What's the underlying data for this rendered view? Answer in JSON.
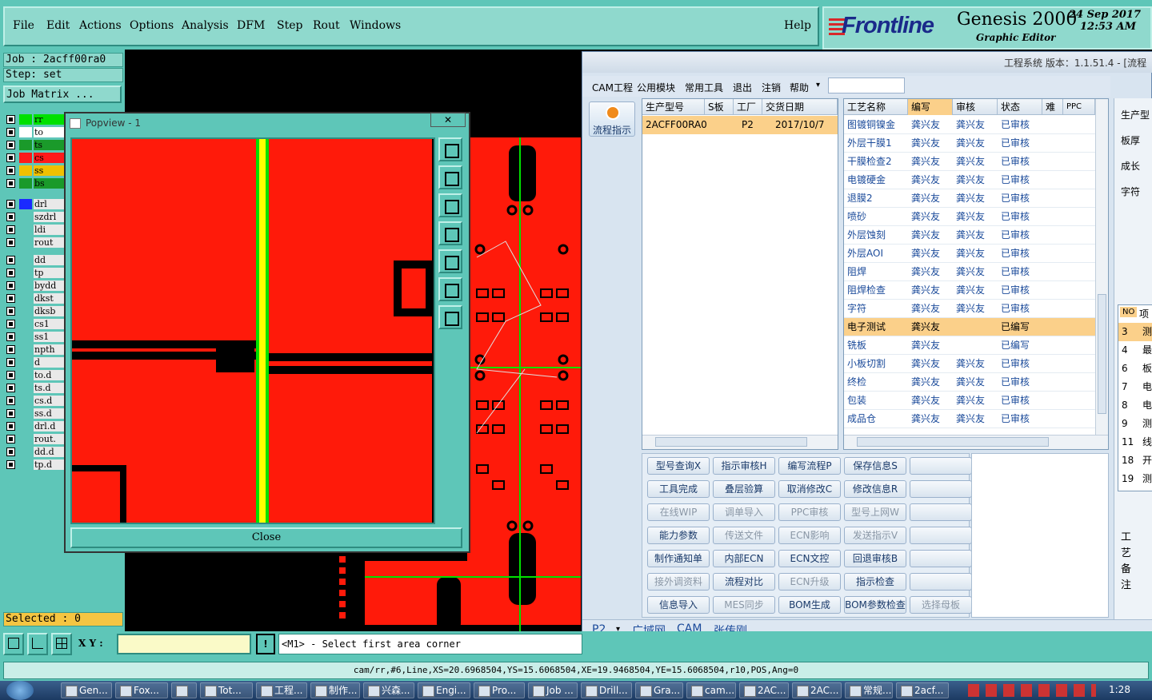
{
  "menu": {
    "items": [
      "File",
      "Edit",
      "Actions",
      "Options",
      "Analysis",
      "DFM",
      "Step",
      "Rout",
      "Windows"
    ],
    "help": "Help"
  },
  "logo": {
    "brand": "Frontline",
    "product": "Genesis 2000",
    "subtitle": "Graphic Editor",
    "date": "24 Sep 2017",
    "time": "12:53 AM"
  },
  "left": {
    "job": "Job : 2acff00ra0",
    "step": "Step: set",
    "job_matrix": "Job Matrix ...",
    "selected": "Selected : 0",
    "layers": [
      {
        "name": "rr",
        "color": "#00e000"
      },
      {
        "name": "to",
        "color": "#ffffff"
      },
      {
        "name": "ts",
        "color": "#1a9a2a"
      },
      {
        "name": "cs",
        "color": "#ff1a1a"
      },
      {
        "name": "ss",
        "color": "#f0c000"
      },
      {
        "name": "bs",
        "color": "#1a9a2a"
      },
      {
        "name": "drl",
        "color": "#1a2aff"
      },
      {
        "name": "szdrl",
        "color": "#5ec6b8"
      },
      {
        "name": "ldi",
        "color": "#5ec6b8"
      },
      {
        "name": "rout",
        "color": "#5ec6b8"
      },
      {
        "name": "dd",
        "color": "#5ec6b8"
      },
      {
        "name": "tp",
        "color": "#5ec6b8"
      },
      {
        "name": "bydd",
        "color": "#5ec6b8"
      },
      {
        "name": "dkst",
        "color": "#5ec6b8"
      },
      {
        "name": "dksb",
        "color": "#5ec6b8"
      },
      {
        "name": "cs1",
        "color": "#5ec6b8"
      },
      {
        "name": "ss1",
        "color": "#5ec6b8"
      },
      {
        "name": "npth",
        "color": "#5ec6b8"
      },
      {
        "name": "d",
        "color": "#5ec6b8"
      },
      {
        "name": "to.d",
        "color": "#5ec6b8"
      },
      {
        "name": "ts.d",
        "color": "#5ec6b8"
      },
      {
        "name": "cs.d",
        "color": "#5ec6b8"
      },
      {
        "name": "ss.d",
        "color": "#5ec6b8"
      },
      {
        "name": "drl.d",
        "color": "#5ec6b8"
      },
      {
        "name": "rout.",
        "color": "#5ec6b8"
      },
      {
        "name": "dd.d",
        "color": "#5ec6b8"
      },
      {
        "name": "tp.d",
        "color": "#5ec6b8"
      }
    ]
  },
  "popview": {
    "title": "Popview - 1",
    "close_x": "✕",
    "close": "Close"
  },
  "cmd": {
    "xy_label": "X Y :",
    "xy_value": "",
    "bang": "!",
    "prompt": "<M1> - Select first area corner"
  },
  "status": "cam/rr,#6,Line,XS=20.6968504,YS=15.6068504,XE=19.9468504,YE=15.6068504,r10,POS,Ang=0",
  "eng": {
    "title": "工程系统  版本：1.1.51.4 - [流程",
    "menus": [
      "CAM工程",
      "公用模块",
      "常用工具",
      "退出",
      "注销",
      "帮助"
    ],
    "flow_btn": "流程指示",
    "order_headers": [
      "生产型号",
      "S板",
      "工厂",
      "交货日期"
    ],
    "order_row": [
      "2ACFF00RA0",
      "",
      "P2",
      "2017/10/7"
    ],
    "proc_headers": [
      "工艺名称",
      "编写",
      "审核",
      "状态",
      "难",
      "PPC"
    ],
    "procs": [
      [
        "图镀铜镍金",
        "龚兴友",
        "龚兴友",
        "已审核"
      ],
      [
        "外层干膜1",
        "龚兴友",
        "龚兴友",
        "已审核"
      ],
      [
        "干膜检查2",
        "龚兴友",
        "龚兴友",
        "已审核"
      ],
      [
        "电镀硬金",
        "龚兴友",
        "龚兴友",
        "已审核"
      ],
      [
        "退膜2",
        "龚兴友",
        "龚兴友",
        "已审核"
      ],
      [
        "喷砂",
        "龚兴友",
        "龚兴友",
        "已审核"
      ],
      [
        "外层蚀刻",
        "龚兴友",
        "龚兴友",
        "已审核"
      ],
      [
        "外层AOI",
        "龚兴友",
        "龚兴友",
        "已审核"
      ],
      [
        "阻焊",
        "龚兴友",
        "龚兴友",
        "已审核"
      ],
      [
        "阻焊检查",
        "龚兴友",
        "龚兴友",
        "已审核"
      ],
      [
        "字符",
        "龚兴友",
        "龚兴友",
        "已审核"
      ],
      [
        "电子测试",
        "龚兴友",
        "",
        "已编写"
      ],
      [
        "铣板",
        "龚兴友",
        "",
        "已编写"
      ],
      [
        "小板切割",
        "龚兴友",
        "龚兴友",
        "已审核"
      ],
      [
        "终检",
        "龚兴友",
        "龚兴友",
        "已审核"
      ],
      [
        "包装",
        "龚兴友",
        "龚兴友",
        "已审核"
      ],
      [
        "成品仓",
        "龚兴友",
        "龚兴友",
        "已审核"
      ]
    ],
    "buttons": [
      [
        "型号查询X",
        "指示审核H",
        "编写流程P",
        "保存信息S",
        ""
      ],
      [
        "工具完成",
        "叠层验算",
        "取消修改C",
        "修改信息R",
        ""
      ],
      [
        "在线WIP",
        "调单导入",
        "PPC审核",
        "型号上网W",
        ""
      ],
      [
        "能力参数",
        "传送文件",
        "ECN影响",
        "发送指示V",
        ""
      ],
      [
        "制作通知单",
        "内部ECN",
        "ECN文控",
        "回退审核B",
        ""
      ],
      [
        "接外调资料",
        "流程对比",
        "ECN升级",
        "指示检查",
        ""
      ],
      [
        "信息导入",
        "MES同步",
        "BOM生成",
        "BOM参数检查",
        "选择母板"
      ]
    ],
    "disabled": [
      "调单导入",
      "PPC审核",
      "型号上网W",
      "传送文件",
      "ECN影响",
      "发送指示V",
      "接外调资料",
      "ECN升级",
      "MES同步",
      "选择母板",
      "在线WIP"
    ],
    "bottom_tabs": [
      "P2",
      "广域网",
      "CAM",
      "张传刚"
    ],
    "right_labels": [
      "生产型",
      "板厚",
      "成长",
      "字符"
    ],
    "right_list_hdr": [
      "NO",
      "项"
    ],
    "right_list": [
      [
        "3",
        "测"
      ],
      [
        "4",
        "最"
      ],
      [
        "6",
        "板"
      ],
      [
        "7",
        "电"
      ],
      [
        "8",
        "电"
      ],
      [
        "9",
        "测"
      ],
      [
        "11",
        "线"
      ],
      [
        "18",
        "开"
      ],
      [
        "19",
        "测"
      ]
    ],
    "remark": "工艺备注"
  },
  "taskbar": {
    "items": [
      "Gen...",
      "Fox...",
      "",
      "Tot...",
      "工程...",
      "制作...",
      "兴森...",
      "Engi...",
      "Pro...",
      "Job ...",
      "Drill...",
      "Gra...",
      "cam...",
      "2AC...",
      "2AC...",
      "常规...",
      "2acf..."
    ],
    "clock": "1:28"
  }
}
